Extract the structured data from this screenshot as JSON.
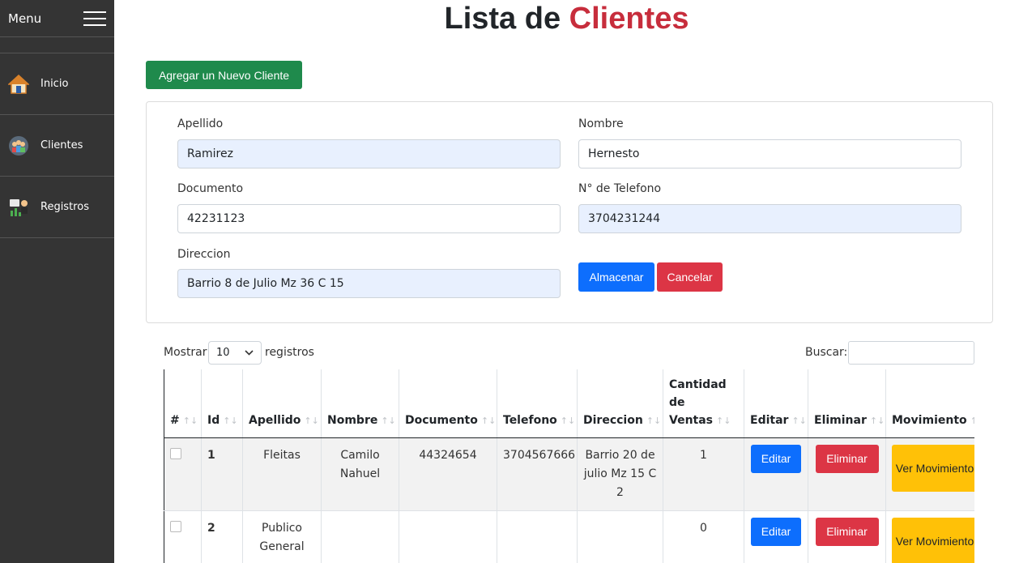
{
  "sidebar": {
    "menu_title": "Menu",
    "items": [
      {
        "label": "Inicio",
        "icon": "home-icon"
      },
      {
        "label": "Clientes",
        "icon": "clients-icon"
      },
      {
        "label": "Registros",
        "icon": "records-icon"
      }
    ]
  },
  "page": {
    "title_part1": "Lista de ",
    "title_part2": "Clientes",
    "accent_color": "#c72d3c"
  },
  "toolbar": {
    "add_label": "Agregar un Nuevo Cliente"
  },
  "form": {
    "apellido_label": "Apellido",
    "apellido_value": "Ramirez",
    "nombre_label": "Nombre",
    "nombre_value": "Hernesto",
    "documento_label": "Documento",
    "documento_value": "42231123",
    "telefono_label": "N° de Telefono",
    "telefono_value": "3704231244",
    "direccion_label": "Direccion",
    "direccion_value": "Barrio 8 de Julio Mz 36 C 15",
    "save_label": "Almacenar",
    "cancel_label": "Cancelar"
  },
  "table_controls": {
    "show_label": "Mostrar",
    "length_value": "10",
    "records_label": "registros",
    "search_label": "Buscar:",
    "search_value": ""
  },
  "table": {
    "headers": {
      "num": "#",
      "id": "Id",
      "apellido": "Apellido",
      "nombre": "Nombre",
      "documento": "Documento",
      "telefono": "Telefono",
      "direccion": "Direccion",
      "cantidad": "Cantidad de Ventas",
      "editar": "Editar",
      "eliminar": "Eliminar",
      "movimiento": "Movimiento"
    },
    "sort_glyph": "↑↓",
    "rows": [
      {
        "id": "1",
        "apellido": "Fleitas",
        "nombre": "Camilo Nahuel",
        "documento": "44324654",
        "telefono": "3704567666",
        "direccion": "Barrio 20 de julio Mz 15 C 2",
        "cantidad": "1",
        "edit_label": "Editar",
        "delete_label": "Eliminar",
        "move_label": "Ver Movimiento"
      },
      {
        "id": "2",
        "apellido": "Publico General",
        "nombre": "",
        "documento": "",
        "telefono": "",
        "direccion": "",
        "cantidad": "0",
        "edit_label": "Editar",
        "delete_label": "Eliminar",
        "move_label": "Ver Movimiento"
      }
    ]
  }
}
